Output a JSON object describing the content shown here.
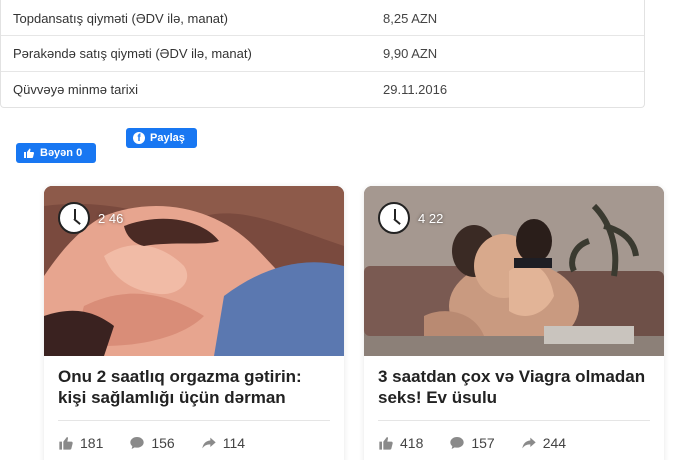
{
  "table": {
    "rows": [
      {
        "label": "Topdansatış qiyməti (ƏDV ilə, manat)",
        "value": "8,25 AZN"
      },
      {
        "label": "Pərakəndə satış qiyməti (ƏDV ilə, manat)",
        "value": "9,90 AZN"
      },
      {
        "label": "Qüvvəyə minmə tarixi",
        "value": "29.11.2016"
      }
    ]
  },
  "social": {
    "share_label": "Paylaş",
    "like_label": "Bəyən 0"
  },
  "cards": [
    {
      "duration": "2 46",
      "title": "Onu 2 saatlıq orgazma gətirin: kişi sağlamlığı üçün dərman",
      "likes": "181",
      "comments": "156",
      "shares": "114"
    },
    {
      "duration": "4 22",
      "title": "3 saatdan çox və Viagra olmadan seks! Ev üsulu",
      "likes": "418",
      "comments": "157",
      "shares": "244"
    }
  ]
}
